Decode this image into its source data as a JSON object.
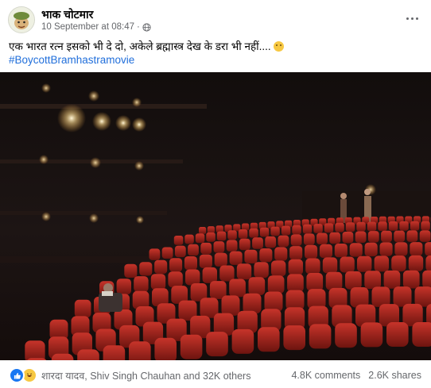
{
  "post": {
    "author": "भाक चोटमार",
    "date": "10 September at 08:47",
    "separator": "·",
    "text": "एक भारत रत्न इसको भी दे दो, अकेले ब्रह्मास्त्र देख के डरा भी नहीं....",
    "hashtag": "#BoycottBramhastramovie"
  },
  "footer": {
    "reactors": "शारदा यादव, Shiv Singh Chauhan and 32K others",
    "comments": "4.8K comments",
    "shares": "2.6K shares"
  },
  "icons": {
    "avatar": "cartoon-avatar-icon",
    "audience": "globe-icon",
    "more": "more-options-icon",
    "like": "like-reaction-icon",
    "haha": "haha-reaction-icon",
    "emoji": "grinning-emoji-icon"
  },
  "colors": {
    "link": "#216fdb",
    "secondary_text": "#65676b",
    "like_blue": "#1877f2",
    "seat_red": "#b3261c"
  }
}
